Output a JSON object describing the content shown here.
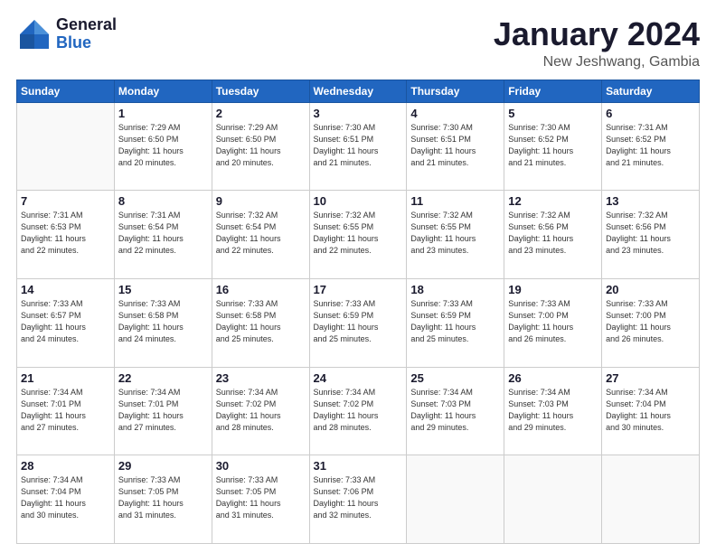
{
  "header": {
    "logo": {
      "general": "General",
      "blue": "Blue"
    },
    "title": "January 2024",
    "location": "New Jeshwang, Gambia"
  },
  "calendar": {
    "days_of_week": [
      "Sunday",
      "Monday",
      "Tuesday",
      "Wednesday",
      "Thursday",
      "Friday",
      "Saturday"
    ],
    "weeks": [
      [
        {
          "day": "",
          "info": ""
        },
        {
          "day": "1",
          "info": "Sunrise: 7:29 AM\nSunset: 6:50 PM\nDaylight: 11 hours\nand 20 minutes."
        },
        {
          "day": "2",
          "info": "Sunrise: 7:29 AM\nSunset: 6:50 PM\nDaylight: 11 hours\nand 20 minutes."
        },
        {
          "day": "3",
          "info": "Sunrise: 7:30 AM\nSunset: 6:51 PM\nDaylight: 11 hours\nand 21 minutes."
        },
        {
          "day": "4",
          "info": "Sunrise: 7:30 AM\nSunset: 6:51 PM\nDaylight: 11 hours\nand 21 minutes."
        },
        {
          "day": "5",
          "info": "Sunrise: 7:30 AM\nSunset: 6:52 PM\nDaylight: 11 hours\nand 21 minutes."
        },
        {
          "day": "6",
          "info": "Sunrise: 7:31 AM\nSunset: 6:52 PM\nDaylight: 11 hours\nand 21 minutes."
        }
      ],
      [
        {
          "day": "7",
          "info": "Sunrise: 7:31 AM\nSunset: 6:53 PM\nDaylight: 11 hours\nand 22 minutes."
        },
        {
          "day": "8",
          "info": "Sunrise: 7:31 AM\nSunset: 6:54 PM\nDaylight: 11 hours\nand 22 minutes."
        },
        {
          "day": "9",
          "info": "Sunrise: 7:32 AM\nSunset: 6:54 PM\nDaylight: 11 hours\nand 22 minutes."
        },
        {
          "day": "10",
          "info": "Sunrise: 7:32 AM\nSunset: 6:55 PM\nDaylight: 11 hours\nand 22 minutes."
        },
        {
          "day": "11",
          "info": "Sunrise: 7:32 AM\nSunset: 6:55 PM\nDaylight: 11 hours\nand 23 minutes."
        },
        {
          "day": "12",
          "info": "Sunrise: 7:32 AM\nSunset: 6:56 PM\nDaylight: 11 hours\nand 23 minutes."
        },
        {
          "day": "13",
          "info": "Sunrise: 7:32 AM\nSunset: 6:56 PM\nDaylight: 11 hours\nand 23 minutes."
        }
      ],
      [
        {
          "day": "14",
          "info": "Sunrise: 7:33 AM\nSunset: 6:57 PM\nDaylight: 11 hours\nand 24 minutes."
        },
        {
          "day": "15",
          "info": "Sunrise: 7:33 AM\nSunset: 6:58 PM\nDaylight: 11 hours\nand 24 minutes."
        },
        {
          "day": "16",
          "info": "Sunrise: 7:33 AM\nSunset: 6:58 PM\nDaylight: 11 hours\nand 25 minutes."
        },
        {
          "day": "17",
          "info": "Sunrise: 7:33 AM\nSunset: 6:59 PM\nDaylight: 11 hours\nand 25 minutes."
        },
        {
          "day": "18",
          "info": "Sunrise: 7:33 AM\nSunset: 6:59 PM\nDaylight: 11 hours\nand 25 minutes."
        },
        {
          "day": "19",
          "info": "Sunrise: 7:33 AM\nSunset: 7:00 PM\nDaylight: 11 hours\nand 26 minutes."
        },
        {
          "day": "20",
          "info": "Sunrise: 7:33 AM\nSunset: 7:00 PM\nDaylight: 11 hours\nand 26 minutes."
        }
      ],
      [
        {
          "day": "21",
          "info": "Sunrise: 7:34 AM\nSunset: 7:01 PM\nDaylight: 11 hours\nand 27 minutes."
        },
        {
          "day": "22",
          "info": "Sunrise: 7:34 AM\nSunset: 7:01 PM\nDaylight: 11 hours\nand 27 minutes."
        },
        {
          "day": "23",
          "info": "Sunrise: 7:34 AM\nSunset: 7:02 PM\nDaylight: 11 hours\nand 28 minutes."
        },
        {
          "day": "24",
          "info": "Sunrise: 7:34 AM\nSunset: 7:02 PM\nDaylight: 11 hours\nand 28 minutes."
        },
        {
          "day": "25",
          "info": "Sunrise: 7:34 AM\nSunset: 7:03 PM\nDaylight: 11 hours\nand 29 minutes."
        },
        {
          "day": "26",
          "info": "Sunrise: 7:34 AM\nSunset: 7:03 PM\nDaylight: 11 hours\nand 29 minutes."
        },
        {
          "day": "27",
          "info": "Sunrise: 7:34 AM\nSunset: 7:04 PM\nDaylight: 11 hours\nand 30 minutes."
        }
      ],
      [
        {
          "day": "28",
          "info": "Sunrise: 7:34 AM\nSunset: 7:04 PM\nDaylight: 11 hours\nand 30 minutes."
        },
        {
          "day": "29",
          "info": "Sunrise: 7:33 AM\nSunset: 7:05 PM\nDaylight: 11 hours\nand 31 minutes."
        },
        {
          "day": "30",
          "info": "Sunrise: 7:33 AM\nSunset: 7:05 PM\nDaylight: 11 hours\nand 31 minutes."
        },
        {
          "day": "31",
          "info": "Sunrise: 7:33 AM\nSunset: 7:06 PM\nDaylight: 11 hours\nand 32 minutes."
        },
        {
          "day": "",
          "info": ""
        },
        {
          "day": "",
          "info": ""
        },
        {
          "day": "",
          "info": ""
        }
      ]
    ]
  }
}
